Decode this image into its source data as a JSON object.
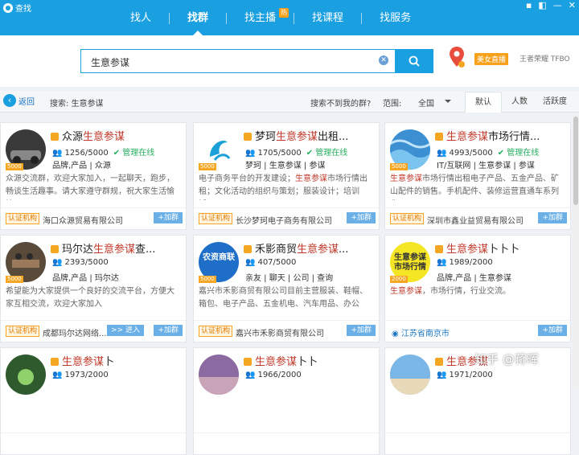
{
  "app": {
    "title": "查找"
  },
  "nav": {
    "items": [
      {
        "label": "找人",
        "active": false
      },
      {
        "label": "找群",
        "active": true
      },
      {
        "label": "找主播",
        "active": false,
        "badge": "热"
      },
      {
        "label": "找课程",
        "active": false
      },
      {
        "label": "找服务",
        "active": false
      }
    ]
  },
  "search": {
    "value": "生意参谋",
    "clear_icon": "clear-icon",
    "button_icon": "search-icon"
  },
  "promo": {
    "beauty_live": "美女直播",
    "links": "王者荣耀  TFBO"
  },
  "filter": {
    "back": "返回",
    "crumb": "搜索: 生意参谋",
    "not_found": "搜索不到我的群?",
    "range_label": "范围:",
    "range_value": "全国",
    "sort_tabs": [
      {
        "label": "默认",
        "active": true
      },
      {
        "label": "人数",
        "active": false
      },
      {
        "label": "活跃度",
        "active": false
      }
    ]
  },
  "groups": [
    {
      "pre": "众源",
      "hl": "生意参谋",
      "post": "",
      "members": "1256/5000",
      "admin": "管理在线",
      "tags": "品牌,产品 | 众源",
      "desc_pre": "众源交流群，欢迎大家加入，一起聊天，跑步，畅谈生活趣事。请大家遵守群规，祝大家生活愉快。",
      "desc_hl": "",
      "desc_post": "",
      "cert": "认证机构",
      "company": "海口众源贸易有限公司",
      "join": "+加群",
      "level": "5000"
    },
    {
      "pre": "梦珂",
      "hl": "生意参谋",
      "post": "出租...",
      "members": "1705/5000",
      "admin": "管理在线",
      "tags": "梦珂 | 生意参谋 | 参谋",
      "desc_pre": "电子商务平台的开发建设；",
      "desc_hl": "生意参谋",
      "desc_post": "市场行情出租；文化活动的组织与策划；服装设计；培训活...",
      "cert": "认证机构",
      "company": "长沙梦珂电子商务有限公司",
      "join": "+加群",
      "level": "5000"
    },
    {
      "pre": "",
      "hl": "生意参谋",
      "post": "市场行情...",
      "members": "4993/5000",
      "admin": "管理在线",
      "tags": "IT/互联网 | 生意参谋 | 参谋",
      "desc_pre": "",
      "desc_hl": "生意参谋",
      "desc_post": "市场行情出租电子产品、五金产品、矿山配件的销售。手机配件、装修运营直通车系列化...",
      "cert": "认证机构",
      "company": "深圳市鑫业益贸易有限公司",
      "join": "+加群",
      "level": "5000"
    },
    {
      "pre": "玛尔达",
      "hl": "生意参谋",
      "post": "查...",
      "members": "2393/5000",
      "admin": "",
      "tags": "品牌,产品 | 玛尔达",
      "desc_pre": "希望能为大家提供一个良好的交流平台，方便大家互相交流，欢迎大家加入",
      "desc_hl": "",
      "desc_post": "",
      "cert": "认证机构",
      "company": "成都玛尔达网络...",
      "enter": ">> 进入",
      "join": "+加群",
      "level": "5000"
    },
    {
      "pre": "禾影商贸",
      "hl": "生意参谋",
      "post": "...",
      "members": "407/5000",
      "admin": "",
      "tags": "亲友 | 聊天 | 公司 | 查询",
      "desc_pre": "嘉兴市禾影商贸有限公司目前主营服装、鞋帽、箱包、电子产品、五金机电、汽车用品、办公用...",
      "desc_hl": "",
      "desc_post": "",
      "cert": "认证机构",
      "company": "嘉兴市禾影商贸有限公司",
      "join": "+加群",
      "level": "5000"
    },
    {
      "pre": "",
      "hl": "生意参谋",
      "post": "卜卜卜",
      "members": "1989/2000",
      "admin": "",
      "tags": "品牌,产品 | 生意参谋",
      "desc_pre": "",
      "desc_hl": "生意参谋",
      "desc_post": "，市场行情，行业交流。",
      "cert": "",
      "location": "江苏省南京市",
      "join": "+加群",
      "level": "2000"
    },
    {
      "pre": "",
      "hl": "生意参谋",
      "post": "卜",
      "members": "1973/2000",
      "admin": "",
      "tags": "",
      "desc_pre": "",
      "desc_hl": "",
      "desc_post": "",
      "cert": "",
      "company": "",
      "join": "",
      "level": ""
    },
    {
      "pre": "",
      "hl": "生意参谋",
      "post": "卜卜",
      "members": "1966/2000",
      "admin": "",
      "tags": "",
      "desc_pre": "",
      "desc_hl": "",
      "desc_post": "",
      "cert": "",
      "company": "",
      "join": "",
      "level": ""
    },
    {
      "pre": "",
      "hl": "生意参谋",
      "post": "",
      "members": "1971/2000",
      "admin": "",
      "tags": "",
      "desc_pre": "",
      "desc_hl": "",
      "desc_post": "",
      "cert": "",
      "company": "",
      "join": "",
      "level": ""
    }
  ],
  "avatar_text": {
    "g5": "农资商联",
    "g6": "生意参谋 市场行情"
  },
  "watermark": "知乎 @蒋晖",
  "colors": {
    "primary": "#1a9fe0",
    "highlight": "#c0392b",
    "badge": "#f5a623"
  }
}
